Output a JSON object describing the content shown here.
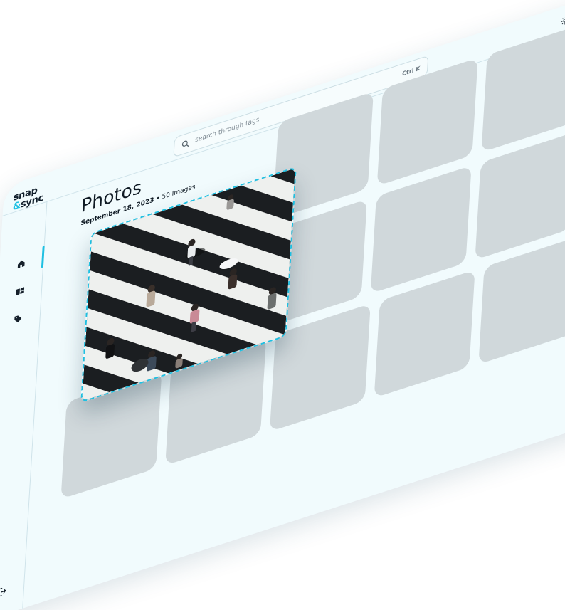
{
  "app": {
    "logo_line1": "snap",
    "logo_amp": "&",
    "logo_line2": "sync"
  },
  "search": {
    "placeholder": "search through tags",
    "shortcut": "Ctrl K"
  },
  "sidebar": {
    "items": [
      {
        "icon": "home-icon",
        "active": true
      },
      {
        "icon": "albums-icon",
        "active": false
      },
      {
        "icon": "tag-icon",
        "active": false
      }
    ],
    "footer_icon": "logout-icon"
  },
  "header": {
    "theme_icon": "sun-icon",
    "upload_icon": "upload-icon"
  },
  "main": {
    "title": "Photos",
    "date": "September 18, 2023",
    "separator": "•",
    "count": "50 Images"
  },
  "colors": {
    "accent": "#1ec0e2",
    "background": "#f1fbfd",
    "placeholder_tile": "#d0d8db",
    "text": "#0f1a24"
  }
}
